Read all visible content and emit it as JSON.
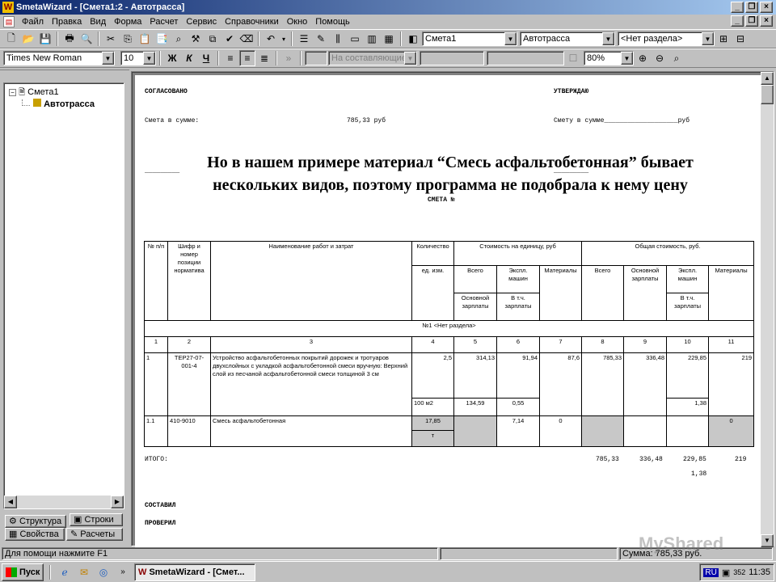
{
  "window": {
    "title": "SmetaWizard - [Смета1:2 - Автотрасса]"
  },
  "menu": [
    "Файл",
    "Правка",
    "Вид",
    "Форма",
    "Расчет",
    "Сервис",
    "Справочники",
    "Окно",
    "Помощь"
  ],
  "toolbar1": {
    "estimate_combo": "Смета1",
    "object_combo": "Автотрасса",
    "section_combo": "<Нет раздела>"
  },
  "toolbar2": {
    "font_combo": "Times New Roman",
    "size_combo": "10",
    "bold": "Ж",
    "italic": "К",
    "underline": "Ч",
    "composite_combo": "На составляющие",
    "zoom_combo": "80%"
  },
  "tree": {
    "root": "Смета1",
    "child": "Автотрасса"
  },
  "left_tabs": {
    "structure": "Структура",
    "rows": "Строки",
    "properties": "Свойства",
    "calcs": "Расчеты"
  },
  "doc": {
    "agreed": "СОГЛАСОВАНО",
    "approve": "УТВЕРЖДАЮ",
    "sum_left_label": "Смета в сумме:",
    "sum_left_value": "785,33 руб",
    "sum_right": "Смету в сумме___________________руб",
    "dashes_left": "_________",
    "dashes_right": "_________",
    "smeta_no": "СМЕТА №",
    "overlay": "Но в нашем примере материал “Смесь асфальтобетонная” бывает нескольких видов, поэтому программа не подобрала к нему цену",
    "itogo": "ИТОГО:",
    "itogo_values": [
      "785,33",
      "336,48",
      "229,85",
      "219"
    ],
    "itogo_extra": "1,38",
    "composed": "СОСТАВИЛ",
    "checked": "ПРОВЕРИЛ"
  },
  "table": {
    "h_no": "№ п/п",
    "h_code": "Шифр и номер позиции норматива",
    "h_name": "Наименование работ и затрат",
    "h_qty": "Количество",
    "h_unit": "ед. изм.",
    "h_unitcost": "Стоимость на единицу, руб",
    "h_total": "Общая стоимость, руб.",
    "h_all": "Всего",
    "h_mach": "Экспл. машин",
    "h_mat": "Материалы",
    "h_base_salary": "Основной зарплаты",
    "h_incl_salary": "В т.ч. зарплаты",
    "section": "№1 <Нет раздела>",
    "colnums": [
      "1",
      "2",
      "3",
      "4",
      "5",
      "6",
      "7",
      "8",
      "9",
      "10",
      "11"
    ],
    "row1": {
      "no": "1",
      "code": "ТЕР27-07-001-4",
      "name": "Устройство асфальтобетонных покрытий дорожек и тротуаров двухслойных с укладкой асфальтобетонной смеси вручную: Верхний слой из песчаной асфальтобетонной смеси толщиной 3 см",
      "qty": "2,5",
      "unit": "100 м2",
      "c5": "314,13",
      "c5b": "134,59",
      "c6": "91,94",
      "c6b": "0,55",
      "c7": "87,6",
      "c8": "785,33",
      "c9": "336,48",
      "c10": "229,85",
      "c10b": "1,38",
      "c11": "219"
    },
    "row2": {
      "no": "1.1",
      "code": "410-9010",
      "name": "Смесь асфальтобетонная",
      "qty": "17,85",
      "unit": "т",
      "c6": "7,14",
      "c7": "0",
      "c11": "0"
    }
  },
  "status": {
    "help": "Для помощи нажмите F1",
    "sum": "Сумма: 785,33 руб."
  },
  "taskbar": {
    "start": "Пуск",
    "task": "SmetaWizard - [Смет...",
    "lang": "RU",
    "num": "352",
    "time": "11:35"
  },
  "watermark": "MyShared"
}
